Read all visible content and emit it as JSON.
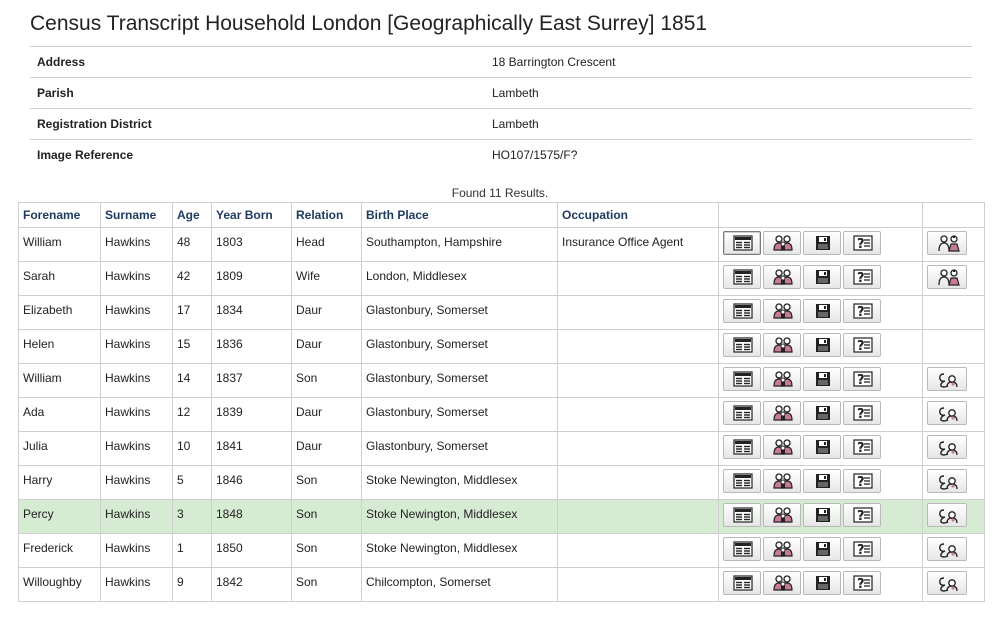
{
  "title": "Census Transcript Household London [Geographically East Surrey] 1851",
  "info": [
    {
      "label": "Address",
      "value": "18 Barrington Crescent"
    },
    {
      "label": "Parish",
      "value": "Lambeth"
    },
    {
      "label": "Registration District",
      "value": "Lambeth"
    },
    {
      "label": "Image Reference",
      "value": "HO107/1575/F?"
    }
  ],
  "found_text": "Found 11 Results.",
  "columns": [
    "Forename",
    "Surname",
    "Age",
    "Year Born",
    "Relation",
    "Birth Place",
    "Occupation"
  ],
  "rows": [
    {
      "forename": "William",
      "surname": "Hawkins",
      "age": "48",
      "year_born": "1803",
      "relation": "Head",
      "birth_place": "Southampton, Hampshire",
      "occupation": "Insurance Office Agent",
      "family_icon": "couple-icon",
      "selected_transcript": true,
      "highlight": false
    },
    {
      "forename": "Sarah",
      "surname": "Hawkins",
      "age": "42",
      "year_born": "1809",
      "relation": "Wife",
      "birth_place": "London, Middlesex",
      "occupation": "",
      "family_icon": "couple-icon",
      "selected_transcript": false,
      "highlight": false
    },
    {
      "forename": "Elizabeth",
      "surname": "Hawkins",
      "age": "17",
      "year_born": "1834",
      "relation": "Daur",
      "birth_place": "Glastonbury, Somerset",
      "occupation": "",
      "family_icon": "",
      "selected_transcript": false,
      "highlight": false
    },
    {
      "forename": "Helen",
      "surname": "Hawkins",
      "age": "15",
      "year_born": "1836",
      "relation": "Daur",
      "birth_place": "Glastonbury, Somerset",
      "occupation": "",
      "family_icon": "",
      "selected_transcript": false,
      "highlight": false
    },
    {
      "forename": "William",
      "surname": "Hawkins",
      "age": "14",
      "year_born": "1837",
      "relation": "Son",
      "birth_place": "Glastonbury, Somerset",
      "occupation": "",
      "family_icon": "parents-icon",
      "selected_transcript": false,
      "highlight": false
    },
    {
      "forename": "Ada",
      "surname": "Hawkins",
      "age": "12",
      "year_born": "1839",
      "relation": "Daur",
      "birth_place": "Glastonbury, Somerset",
      "occupation": "",
      "family_icon": "parents-icon",
      "selected_transcript": false,
      "highlight": false
    },
    {
      "forename": "Julia",
      "surname": "Hawkins",
      "age": "10",
      "year_born": "1841",
      "relation": "Daur",
      "birth_place": "Glastonbury, Somerset",
      "occupation": "",
      "family_icon": "parents-icon",
      "selected_transcript": false,
      "highlight": false
    },
    {
      "forename": "Harry",
      "surname": "Hawkins",
      "age": "5",
      "year_born": "1846",
      "relation": "Son",
      "birth_place": "Stoke Newington, Middlesex",
      "occupation": "",
      "family_icon": "parents-icon",
      "selected_transcript": false,
      "highlight": false
    },
    {
      "forename": "Percy",
      "surname": "Hawkins",
      "age": "3",
      "year_born": "1848",
      "relation": "Son",
      "birth_place": "Stoke Newington, Middlesex",
      "occupation": "",
      "family_icon": "parents-icon",
      "selected_transcript": false,
      "highlight": true
    },
    {
      "forename": "Frederick",
      "surname": "Hawkins",
      "age": "1",
      "year_born": "1850",
      "relation": "Son",
      "birth_place": "Stoke Newington, Middlesex",
      "occupation": "",
      "family_icon": "parents-icon",
      "selected_transcript": false,
      "highlight": false
    },
    {
      "forename": "Willoughby",
      "surname": "Hawkins",
      "age": "9",
      "year_born": "1842",
      "relation": "Son",
      "birth_place": "Chilcompton, Somerset",
      "occupation": "",
      "family_icon": "parents-icon",
      "selected_transcript": false,
      "highlight": false
    }
  ],
  "row_action_icons": [
    "transcript-icon",
    "household-icon",
    "save-icon",
    "help-icon"
  ],
  "colors": {
    "highlight_row": "#d6ecd2",
    "header_text": "#1f3a5f",
    "occupation_link": "#1f3a6f",
    "icon_pink": "#c87a9a"
  }
}
